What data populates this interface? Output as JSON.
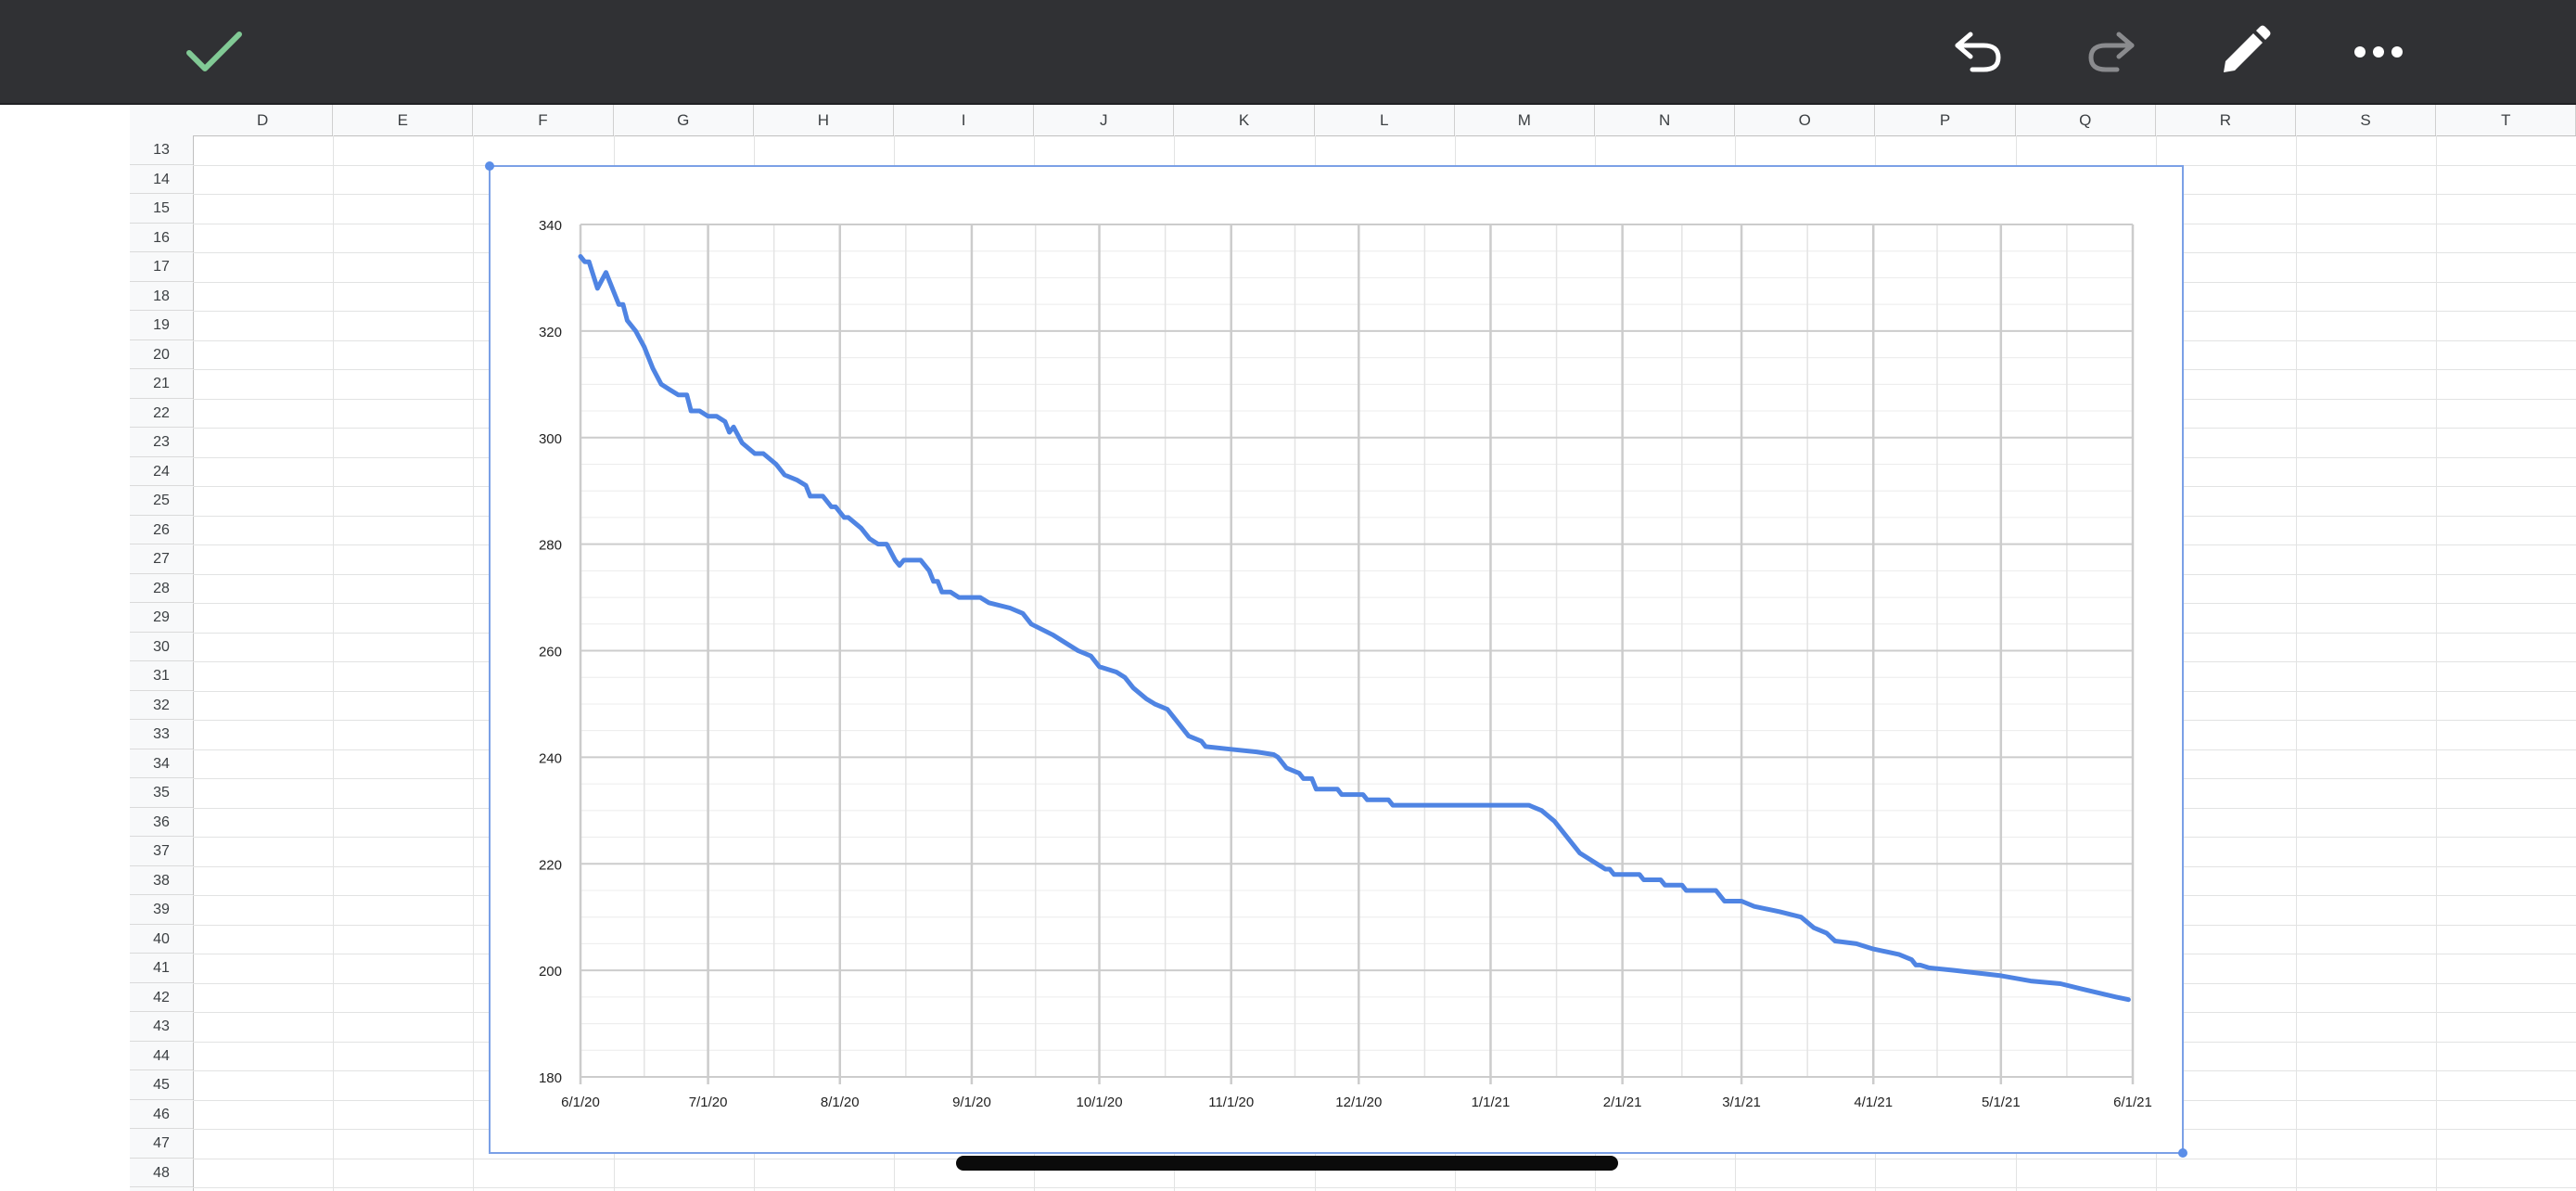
{
  "toolbar": {
    "confirm_icon": "checkmark-icon",
    "undo_icon": "undo-icon",
    "redo_icon": "redo-icon",
    "edit_icon": "pencil-icon",
    "more_icon": "more-horizontal-icon",
    "confirm_color": "#81c995"
  },
  "sheet": {
    "columns": [
      "D",
      "E",
      "F",
      "G",
      "H",
      "I",
      "J",
      "K",
      "L",
      "M",
      "N",
      "O",
      "P",
      "Q",
      "R",
      "S",
      "T"
    ],
    "rows": [
      "13",
      "14",
      "15",
      "16",
      "17",
      "18",
      "19",
      "20",
      "21",
      "22",
      "23",
      "24",
      "25",
      "26",
      "27",
      "28",
      "29",
      "30",
      "31",
      "32",
      "33",
      "34",
      "35",
      "36",
      "37",
      "38",
      "39",
      "40",
      "41",
      "42",
      "43",
      "44",
      "45",
      "46",
      "47",
      "48"
    ]
  },
  "chart_data": {
    "type": "line",
    "title": "",
    "xlabel": "",
    "ylabel": "",
    "ylim": [
      180,
      340
    ],
    "yticks": [
      180,
      200,
      220,
      240,
      260,
      280,
      300,
      320,
      340
    ],
    "xticks": [
      "6/1/20",
      "7/1/20",
      "8/1/20",
      "9/1/20",
      "10/1/20",
      "11/1/20",
      "12/1/20",
      "1/1/21",
      "2/1/21",
      "3/1/21",
      "4/1/21",
      "5/1/21",
      "6/1/21"
    ],
    "xlim": [
      "2020-06-01",
      "2021-06-01"
    ],
    "grid": true,
    "line_color": "#4f84e3",
    "series": [
      {
        "name": "",
        "points": [
          [
            "2020-06-01",
            334
          ],
          [
            "2020-06-02",
            333
          ],
          [
            "2020-06-03",
            333
          ],
          [
            "2020-06-05",
            328
          ],
          [
            "2020-06-07",
            331
          ],
          [
            "2020-06-09",
            327
          ],
          [
            "2020-06-10",
            325
          ],
          [
            "2020-06-11",
            325
          ],
          [
            "2020-06-12",
            322
          ],
          [
            "2020-06-14",
            320
          ],
          [
            "2020-06-16",
            317
          ],
          [
            "2020-06-18",
            313
          ],
          [
            "2020-06-20",
            310
          ],
          [
            "2020-06-22",
            309
          ],
          [
            "2020-06-24",
            308
          ],
          [
            "2020-06-26",
            308
          ],
          [
            "2020-06-27",
            305
          ],
          [
            "2020-06-29",
            305
          ],
          [
            "2020-07-01",
            304
          ],
          [
            "2020-07-03",
            304
          ],
          [
            "2020-07-05",
            303
          ],
          [
            "2020-07-06",
            301
          ],
          [
            "2020-07-07",
            302
          ],
          [
            "2020-07-09",
            299
          ],
          [
            "2020-07-12",
            297
          ],
          [
            "2020-07-14",
            297
          ],
          [
            "2020-07-17",
            295
          ],
          [
            "2020-07-19",
            293
          ],
          [
            "2020-07-22",
            292
          ],
          [
            "2020-07-24",
            291
          ],
          [
            "2020-07-25",
            289
          ],
          [
            "2020-07-28",
            289
          ],
          [
            "2020-07-30",
            287
          ],
          [
            "2020-07-31",
            287
          ],
          [
            "2020-08-02",
            285
          ],
          [
            "2020-08-03",
            285
          ],
          [
            "2020-08-06",
            283
          ],
          [
            "2020-08-08",
            281
          ],
          [
            "2020-08-10",
            280
          ],
          [
            "2020-08-12",
            280
          ],
          [
            "2020-08-14",
            277
          ],
          [
            "2020-08-15",
            276
          ],
          [
            "2020-08-16",
            277
          ],
          [
            "2020-08-20",
            277
          ],
          [
            "2020-08-22",
            275
          ],
          [
            "2020-08-23",
            273
          ],
          [
            "2020-08-24",
            273
          ],
          [
            "2020-08-25",
            271
          ],
          [
            "2020-08-27",
            271
          ],
          [
            "2020-08-29",
            270
          ],
          [
            "2020-09-01",
            270
          ],
          [
            "2020-09-03",
            270
          ],
          [
            "2020-09-05",
            269
          ],
          [
            "2020-09-10",
            268
          ],
          [
            "2020-09-13",
            267
          ],
          [
            "2020-09-15",
            265
          ],
          [
            "2020-09-20",
            263
          ],
          [
            "2020-09-26",
            260
          ],
          [
            "2020-09-29",
            259
          ],
          [
            "2020-10-01",
            257
          ],
          [
            "2020-10-05",
            256
          ],
          [
            "2020-10-07",
            255
          ],
          [
            "2020-10-09",
            253
          ],
          [
            "2020-10-12",
            251
          ],
          [
            "2020-10-14",
            250
          ],
          [
            "2020-10-17",
            249
          ],
          [
            "2020-10-19",
            247
          ],
          [
            "2020-10-22",
            244
          ],
          [
            "2020-10-25",
            243
          ],
          [
            "2020-10-26",
            242
          ],
          [
            "2020-11-01",
            241.5
          ],
          [
            "2020-11-07",
            241
          ],
          [
            "2020-11-11",
            240.5
          ],
          [
            "2020-11-12",
            240
          ],
          [
            "2020-11-14",
            238
          ],
          [
            "2020-11-17",
            237
          ],
          [
            "2020-11-18",
            236
          ],
          [
            "2020-11-20",
            236
          ],
          [
            "2020-11-21",
            234
          ],
          [
            "2020-11-26",
            234
          ],
          [
            "2020-11-27",
            233
          ],
          [
            "2020-12-02",
            233
          ],
          [
            "2020-12-03",
            232
          ],
          [
            "2020-12-08",
            232
          ],
          [
            "2020-12-09",
            231
          ],
          [
            "2020-12-20",
            231
          ],
          [
            "2021-01-01",
            231
          ],
          [
            "2021-01-10",
            231
          ],
          [
            "2021-01-13",
            230
          ],
          [
            "2021-01-16",
            228
          ],
          [
            "2021-01-20",
            224
          ],
          [
            "2021-01-22",
            222
          ],
          [
            "2021-01-26",
            220
          ],
          [
            "2021-01-28",
            219
          ],
          [
            "2021-01-29",
            219
          ],
          [
            "2021-01-30",
            218
          ],
          [
            "2021-02-05",
            218
          ],
          [
            "2021-02-06",
            217
          ],
          [
            "2021-02-10",
            217
          ],
          [
            "2021-02-11",
            216
          ],
          [
            "2021-02-15",
            216
          ],
          [
            "2021-02-16",
            215
          ],
          [
            "2021-02-23",
            215
          ],
          [
            "2021-02-25",
            213
          ],
          [
            "2021-03-01",
            213
          ],
          [
            "2021-03-04",
            212
          ],
          [
            "2021-03-10",
            211
          ],
          [
            "2021-03-15",
            210
          ],
          [
            "2021-03-18",
            208
          ],
          [
            "2021-03-21",
            207
          ],
          [
            "2021-03-23",
            205.5
          ],
          [
            "2021-03-28",
            205
          ],
          [
            "2021-04-01",
            204
          ],
          [
            "2021-04-07",
            203
          ],
          [
            "2021-04-10",
            202
          ],
          [
            "2021-04-11",
            201
          ],
          [
            "2021-04-12",
            201
          ],
          [
            "2021-04-14",
            200.5
          ],
          [
            "2021-04-20",
            200
          ],
          [
            "2021-05-01",
            199
          ],
          [
            "2021-05-08",
            198
          ],
          [
            "2021-05-15",
            197.5
          ],
          [
            "2021-05-20",
            196.5
          ],
          [
            "2021-05-28",
            195
          ],
          [
            "2021-05-31",
            194.5
          ]
        ]
      }
    ]
  }
}
